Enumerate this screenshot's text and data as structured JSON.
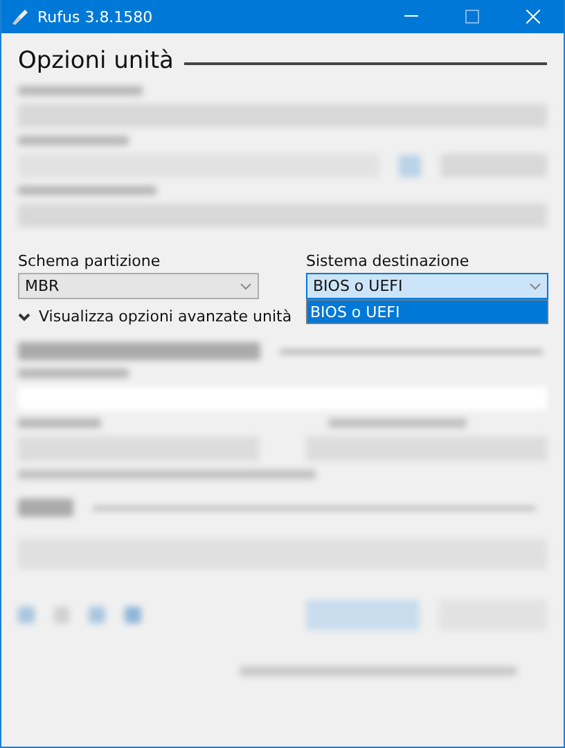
{
  "window": {
    "title": "Rufus 3.8.1580"
  },
  "section": {
    "title": "Opzioni unità"
  },
  "partition_scheme": {
    "label": "Schema partizione",
    "value": "MBR"
  },
  "target_system": {
    "label": "Sistema destinazione",
    "value": "BIOS o UEFI",
    "expanded": true,
    "options": [
      {
        "label": "BIOS o UEFI",
        "selected": true
      }
    ]
  },
  "advanced_toggle": {
    "label": "Visualizza opzioni avanzate unità"
  }
}
